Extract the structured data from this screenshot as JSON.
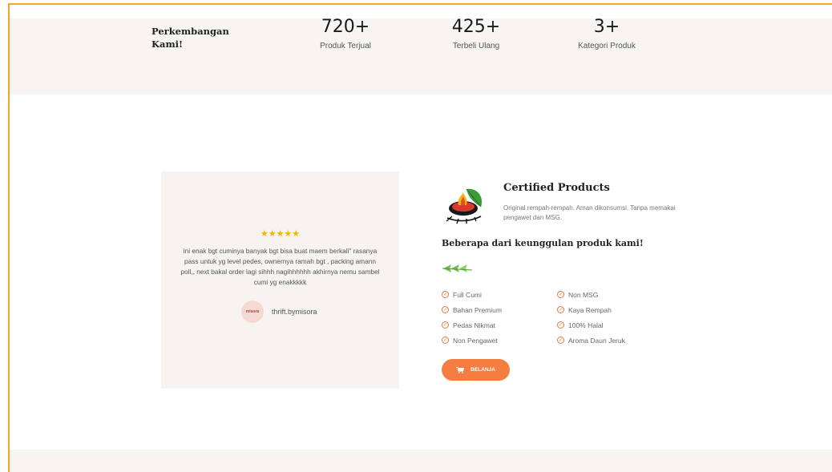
{
  "stats": {
    "title": "Perkembangan Kami!",
    "items": [
      {
        "value": "720+",
        "label": "Produk Terjual"
      },
      {
        "value": "425+",
        "label": "Terbeli Ulang"
      },
      {
        "value": "3+",
        "label": "Kategori Produk"
      }
    ]
  },
  "review": {
    "stars": "★★★★★",
    "text": "ini enak bgt cuminya banyak bgt bisa buat maem berkali\" rasanya pass untuk yg level pedes, ownernya ramah bgt , packing amann poll,, next bakal order lagi sihhh nagihhhhhh akhirnya nemu sambel cumi yg enakkkkk",
    "reviewer": "thrift.bymisora",
    "avatar_text": "misora"
  },
  "certified": {
    "title": "Certified Products",
    "description": "Original rempah-rempah. Aman dikonsumsi. Tanpa memakai pengawet dan MSG."
  },
  "advantages": {
    "heading": "Beberapa dari keunggulan produk kami!",
    "left": [
      "Full Cumi",
      "Bahan Premium",
      "Pedas Nikmat",
      "Non Pengawet"
    ],
    "right": [
      "Non MSG",
      "Kaya Rempah",
      "100% Halal",
      "Aroma Daun Jeruk"
    ]
  },
  "cta": {
    "label": "BELANJA"
  },
  "colors": {
    "accent": "#f57d3f",
    "frame": "#f0a52b",
    "band": "#f8f4f1",
    "stars": "#f4b400"
  }
}
